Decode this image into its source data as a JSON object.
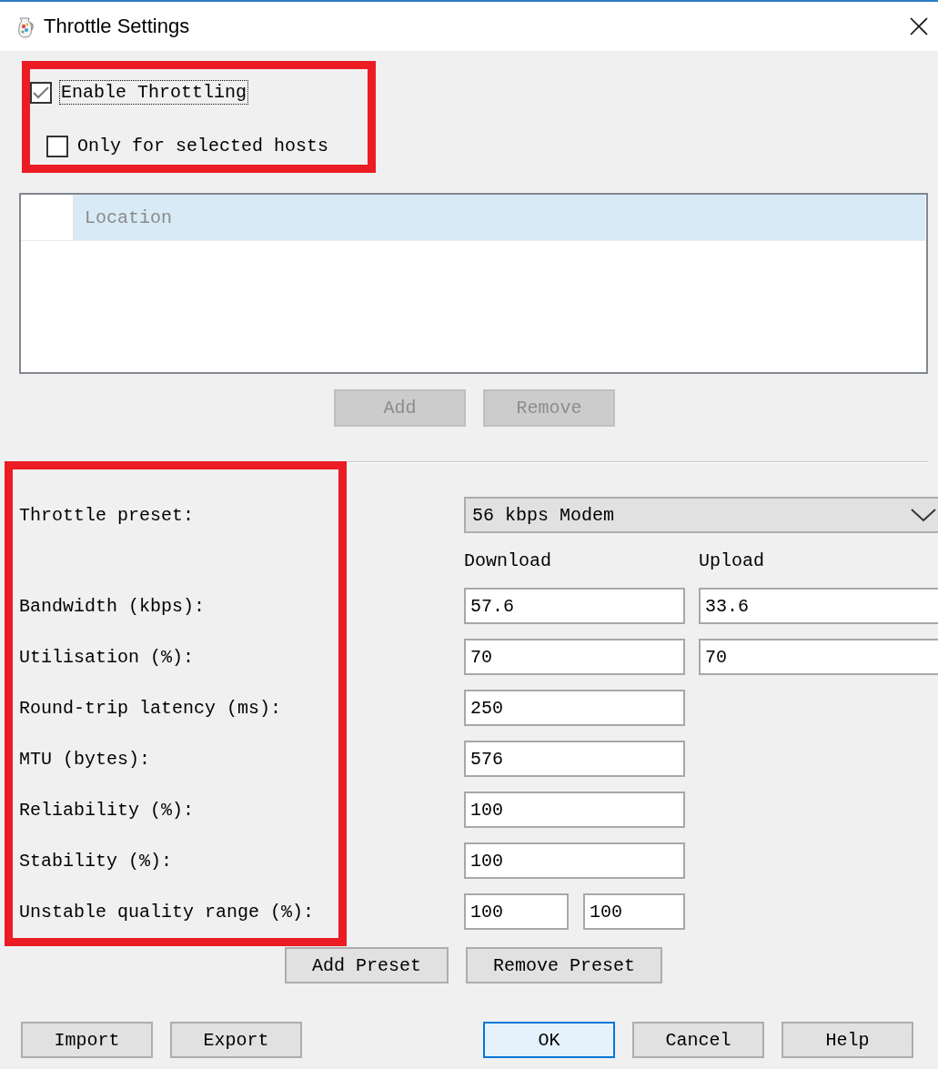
{
  "window": {
    "title": "Throttle Settings"
  },
  "options": [
    {
      "label": "Enable Throttling",
      "checked": true,
      "focused": true,
      "children": [
        {
          "label": "Only for selected hosts",
          "checked": false,
          "focused": false
        }
      ]
    }
  ],
  "hosts_table": {
    "columns": [
      "Location"
    ]
  },
  "host_buttons": [
    {
      "label": "Add",
      "disabled": true
    },
    {
      "label": "Remove",
      "disabled": true
    }
  ],
  "preset": {
    "label": "Throttle preset:",
    "value": "56 kbps Modem"
  },
  "value_columns": [
    "Download",
    "Upload"
  ],
  "settings": [
    {
      "label": "Bandwidth (kbps):",
      "kind": "pair",
      "values": [
        "57.6",
        "33.6"
      ]
    },
    {
      "label": "Utilisation (%):",
      "kind": "pair",
      "values": [
        "70",
        "70"
      ]
    },
    {
      "label": "Round-trip latency (ms):",
      "kind": "single",
      "values": [
        "250"
      ]
    },
    {
      "label": "MTU (bytes):",
      "kind": "single",
      "values": [
        "576"
      ]
    },
    {
      "label": "Reliability (%):",
      "kind": "single",
      "values": [
        "100"
      ]
    },
    {
      "label": "Stability (%):",
      "kind": "single",
      "values": [
        "100"
      ]
    },
    {
      "label": "Unstable quality range (%):",
      "kind": "range",
      "values": [
        "100",
        "100"
      ]
    }
  ],
  "preset_buttons": [
    "Add Preset",
    "Remove Preset"
  ],
  "footer": {
    "left": [
      {
        "label": "Import",
        "default": false
      },
      {
        "label": "Export",
        "default": false
      }
    ],
    "right": [
      {
        "label": "OK",
        "default": true
      },
      {
        "label": "Cancel",
        "default": false
      },
      {
        "label": "Help",
        "default": false
      }
    ]
  }
}
